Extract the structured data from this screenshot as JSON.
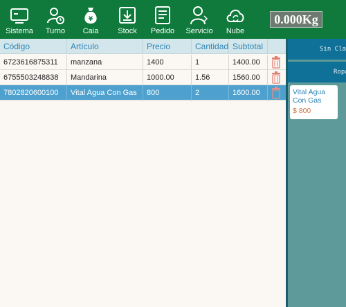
{
  "toolbar": {
    "items": [
      {
        "label": "Sistema",
        "icon": "monitor-icon"
      },
      {
        "label": "Turno",
        "icon": "user-clock-icon"
      },
      {
        "label": "Caia",
        "icon": "money-bag-icon"
      },
      {
        "label": "Stock",
        "icon": "download-box-icon"
      },
      {
        "label": "Pedido",
        "icon": "order-list-icon"
      },
      {
        "label": "Servicio",
        "icon": "service-person-icon"
      },
      {
        "label": "Nube",
        "icon": "cloud-sync-icon"
      }
    ],
    "weight": "0.000Kg"
  },
  "table": {
    "headers": [
      "Código",
      "Artículo",
      "Precio",
      "Cantidad",
      "Subtotal"
    ],
    "rows": [
      {
        "codigo": "6723616875311",
        "articulo": "manzana",
        "precio": "1400",
        "cantidad": "1",
        "subtotal": "1400.00"
      },
      {
        "codigo": "6755503248838",
        "articulo": "Mandarina",
        "precio": "1000.00",
        "cantidad": "1.56",
        "subtotal": "1560.00"
      },
      {
        "codigo": "7802820600100",
        "articulo": "Vital Agua Con Gas",
        "precio": "800",
        "cantidad": "2",
        "subtotal": "1600.00"
      }
    ],
    "selected_row": 2
  },
  "categories": [
    "Sin Clasi",
    "Ropa"
  ],
  "products": [
    {
      "name": "Vital Agua Con Gas",
      "price": "$ 800"
    }
  ],
  "colors": {
    "toolbar": "#0f7a3c",
    "header": "#d3e6ec",
    "selected_row": "#4ea1cf",
    "category": "#0f7197",
    "panel": "#5e9a9a",
    "price": "#d0753e"
  }
}
